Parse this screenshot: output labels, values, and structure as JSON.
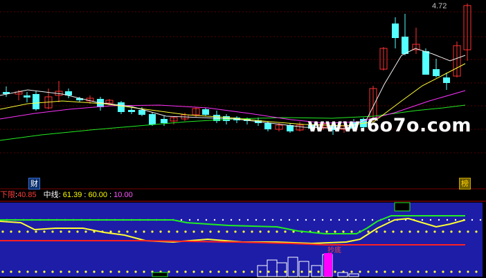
{
  "price_chart": {
    "last_price_label": "4.72",
    "watermark": "www.6o7o.com",
    "marker_left": "财",
    "marker_right": "榜"
  },
  "indicator_panel": {
    "lower_label": "下限",
    "lower_value": "40.85",
    "mid_label": "中线",
    "mid_value": "61.39",
    "upper_level": "60.00",
    "low_level": "10.00",
    "buy_hint": "抄底"
  },
  "colors": {
    "up_candle": "#ff3232",
    "down_candle": "#54ffff",
    "panel_bg": "#1d1da8",
    "green_line": "#22ee22",
    "yellow_line": "#ffff33",
    "red_line": "#ff2020",
    "magenta_bar": "#ff00ff"
  },
  "icons": {
    "marker_left": "cai-finance-icon",
    "marker_right": "bang-ranking-icon"
  }
}
